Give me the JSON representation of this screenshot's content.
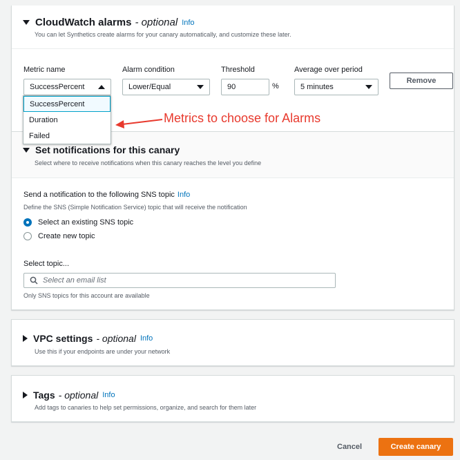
{
  "cloudwatch": {
    "title": "CloudWatch alarms",
    "title_optional": "- optional",
    "info": "Info",
    "description": "You can let Synthetics create alarms for your canary automatically, and customize these later.",
    "labels": {
      "metric_name": "Metric name",
      "alarm_condition": "Alarm condition",
      "threshold": "Threshold",
      "average_over_period": "Average over period"
    },
    "metric_value": "SuccessPercent",
    "alarm_condition_value": "Lower/Equal",
    "threshold_value": "90",
    "threshold_unit": "%",
    "period_value": "5 minutes",
    "remove_label": "Remove",
    "metric_options": [
      "SuccessPercent",
      "Duration",
      "Failed"
    ]
  },
  "annotation": "Metrics to choose for Alarms",
  "notifications": {
    "title": "Set notifications for this canary",
    "description": "Select where to receive notifications when this canary reaches the level you define",
    "sns_label": "Send a notification to the following SNS topic",
    "info": "Info",
    "sns_description": "Define the SNS (Simple Notification Service) topic that will receive the notification",
    "options": [
      "Select an existing SNS topic",
      "Create new topic"
    ],
    "select_topic_label": "Select topic...",
    "search_placeholder": "Select an email list",
    "help_text": "Only SNS topics for this account are available"
  },
  "vpc": {
    "title": "VPC settings",
    "title_optional": "- optional",
    "info": "Info",
    "description": "Use this if your endpoints are under your network"
  },
  "tags": {
    "title": "Tags",
    "title_optional": "- optional",
    "info": "Info",
    "description": "Add tags to canaries to help set permissions, organize, and search for them later"
  },
  "footer": {
    "cancel": "Cancel",
    "create": "Create canary"
  },
  "colors": {
    "primary": "#ec7211",
    "link": "#0073bb",
    "annotation": "#e8392d"
  }
}
